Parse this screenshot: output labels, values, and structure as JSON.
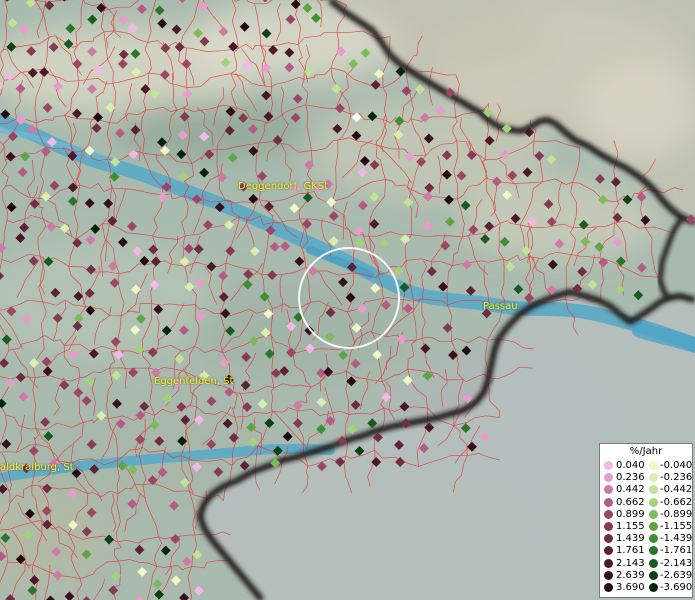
{
  "cities": [
    {
      "id": "deggendorf",
      "label": "Deggendorf, GKSt"
    },
    {
      "id": "passau",
      "label": "Passau"
    },
    {
      "id": "eggenfelden",
      "label": "Eggenfelden, St"
    },
    {
      "id": "waldkraiburg",
      "label": "aldkraiburg, St"
    }
  ],
  "legend": {
    "title": "%/Jahr",
    "positive": [
      {
        "value": "0.040",
        "color": "#f2b8e6"
      },
      {
        "value": "0.236",
        "color": "#e79ccb"
      },
      {
        "value": "0.442",
        "color": "#cf7aa6"
      },
      {
        "value": "0.662",
        "color": "#b65a86"
      },
      {
        "value": "0.899",
        "color": "#9c4666"
      },
      {
        "value": "1.155",
        "color": "#873a55"
      },
      {
        "value": "1.439",
        "color": "#722c44"
      },
      {
        "value": "1.761",
        "color": "#5d2236"
      },
      {
        "value": "2.143",
        "color": "#4a1829"
      },
      {
        "value": "2.639",
        "color": "#37101d"
      },
      {
        "value": "3.690",
        "color": "#230711"
      }
    ],
    "negative": [
      {
        "value": "-0.040",
        "color": "#edf8c6"
      },
      {
        "value": "-0.236",
        "color": "#d9efb0"
      },
      {
        "value": "-0.442",
        "color": "#c0e396"
      },
      {
        "value": "-0.662",
        "color": "#a2d27a"
      },
      {
        "value": "-0.899",
        "color": "#7fbb5d"
      },
      {
        "value": "-1.155",
        "color": "#5fa545"
      },
      {
        "value": "-1.439",
        "color": "#3f8f34"
      },
      {
        "value": "-1.761",
        "color": "#2b7629"
      },
      {
        "value": "-2.143",
        "color": "#1c5b1f"
      },
      {
        "value": "-2.639",
        "color": "#0f3f14"
      },
      {
        "value": "-3.690",
        "color": "#04240a"
      }
    ]
  }
}
